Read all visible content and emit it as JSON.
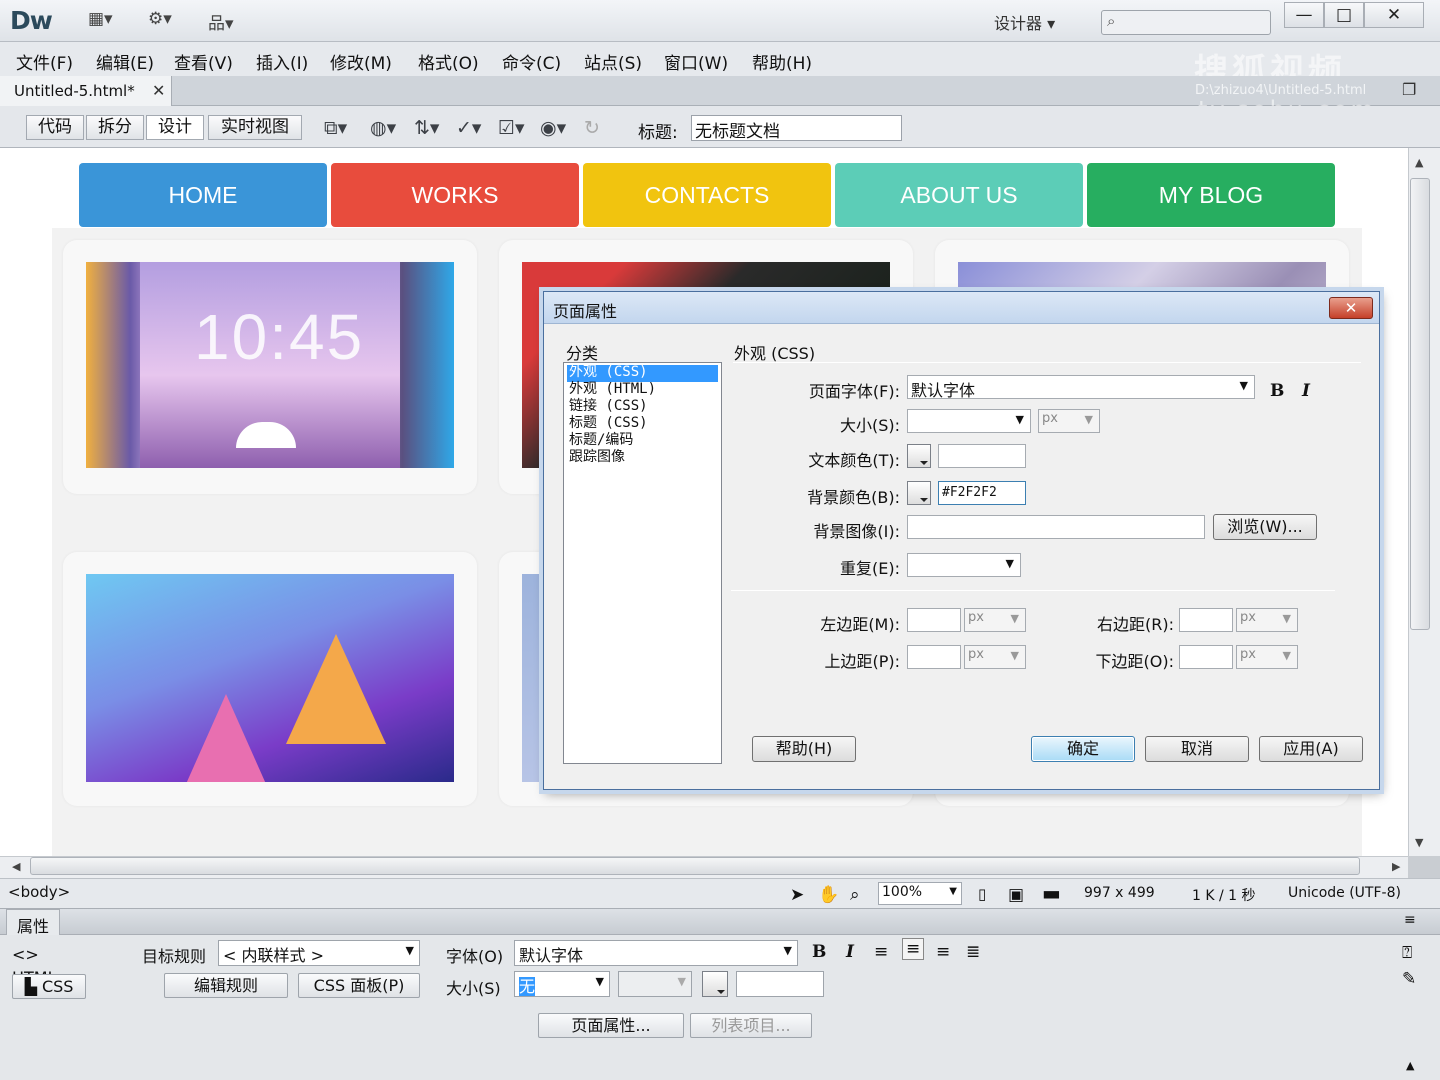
{
  "app": {
    "logo": "Dw",
    "workspace": "设计器",
    "search_placeholder": "",
    "window_buttons": [
      "—",
      "□",
      "✕"
    ]
  },
  "menu": [
    "文件(F)",
    "编辑(E)",
    "查看(V)",
    "插入(I)",
    "修改(M)",
    "格式(O)",
    "命令(C)",
    "站点(S)",
    "窗口(W)",
    "帮助(H)"
  ],
  "document": {
    "tab_label": "Untitled-5.html*",
    "path": "D:\\zhizuo4\\Untitled-5.html",
    "view_buttons": [
      "代码",
      "拆分",
      "设计",
      "实时视图"
    ],
    "title_label": "标题:",
    "title_value": "无标题文档"
  },
  "watermark": {
    "line1": "搜狐视频",
    "line2": "tv.sohu.com"
  },
  "page": {
    "nav": [
      {
        "label": "HOME",
        "color": "#3a95d8"
      },
      {
        "label": "WORKS",
        "color": "#e84c3d"
      },
      {
        "label": "CONTACTS",
        "color": "#f1c40f"
      },
      {
        "label": "ABOUT US",
        "color": "#5ccdb7"
      },
      {
        "label": "MY BLOG",
        "color": "#27ae60"
      }
    ],
    "clock": "10:45"
  },
  "status": {
    "tag": "<body>",
    "zoom": "100%",
    "dimensions": "997 x 499",
    "size_time": "1 K / 1 秒",
    "encoding": "Unicode (UTF-8)"
  },
  "properties": {
    "tab": "属性",
    "html_btn": "HTML",
    "css_btn": "CSS",
    "target_rule_label": "目标规则",
    "target_rule_value": "< 内联样式 >",
    "edit_rule": "编辑规则",
    "css_panel": "CSS 面板(P)",
    "font_label": "字体(O)",
    "font_value": "默认字体",
    "size_label": "大小(S)",
    "size_value": "无",
    "page_props": "页面属性...",
    "list_item": "列表项目..."
  },
  "dialog": {
    "title": "页面属性",
    "category_label": "分类",
    "categories": [
      "外观 (CSS)",
      "外观 (HTML)",
      "链接 (CSS)",
      "标题 (CSS)",
      "标题/编码",
      "跟踪图像"
    ],
    "selected_category": 0,
    "section_title": "外观 (CSS)",
    "page_font_label": "页面字体(F):",
    "page_font_value": "默认字体",
    "bold": "B",
    "italic": "I",
    "size_label": "大小(S):",
    "size_unit": "px",
    "text_color_label": "文本颜色(T):",
    "text_color_value": "",
    "bg_color_label": "背景颜色(B):",
    "bg_color_value": "#F2F2F2",
    "bg_image_label": "背景图像(I):",
    "bg_image_value": "",
    "browse": "浏览(W)...",
    "repeat_label": "重复(E):",
    "left_margin_label": "左边距(M):",
    "right_margin_label": "右边距(R):",
    "top_margin_label": "上边距(P):",
    "bottom_margin_label": "下边距(O):",
    "margin_unit": "px",
    "help": "帮助(H)",
    "ok": "确定",
    "cancel": "取消",
    "apply": "应用(A)"
  }
}
